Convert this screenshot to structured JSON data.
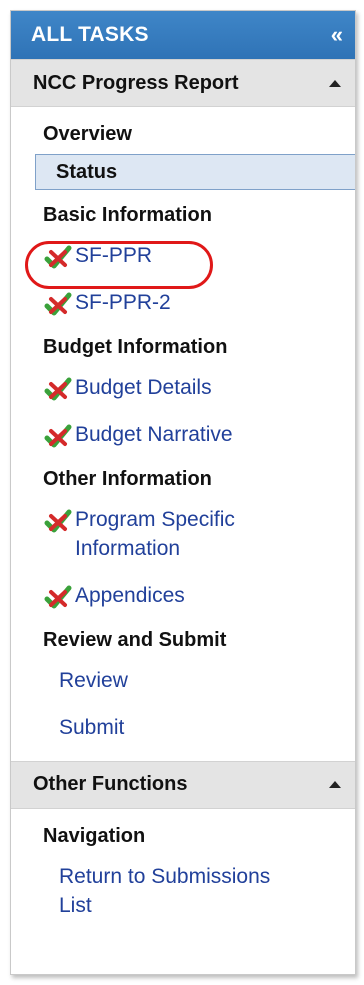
{
  "header": {
    "title": "ALL TASKS",
    "collapse_glyph": "«"
  },
  "sections": {
    "progress": {
      "title": "NCC Progress Report",
      "overview": {
        "heading": "Overview",
        "status_label": "Status"
      },
      "basic": {
        "heading": "Basic Information",
        "item1": "SF-PPR",
        "item2": "SF-PPR-2"
      },
      "budget": {
        "heading": "Budget Information",
        "item1": "Budget Details",
        "item2": "Budget Narrative"
      },
      "other": {
        "heading": "Other Information",
        "item1_line1": "Program Specific",
        "item1_line2": "Information",
        "item2": "Appendices"
      },
      "review": {
        "heading": "Review and Submit",
        "item1": "Review",
        "item2": "Submit"
      }
    },
    "functions": {
      "title": "Other Functions",
      "navigation": {
        "heading": "Navigation",
        "item1_line1": "Return to Submissions",
        "item1_line2": "List"
      }
    }
  },
  "icons": {
    "status_check": "green-check-red-x-icon"
  },
  "colors": {
    "header": "#3278bd",
    "link": "#21409a",
    "highlight": "#e01818"
  }
}
